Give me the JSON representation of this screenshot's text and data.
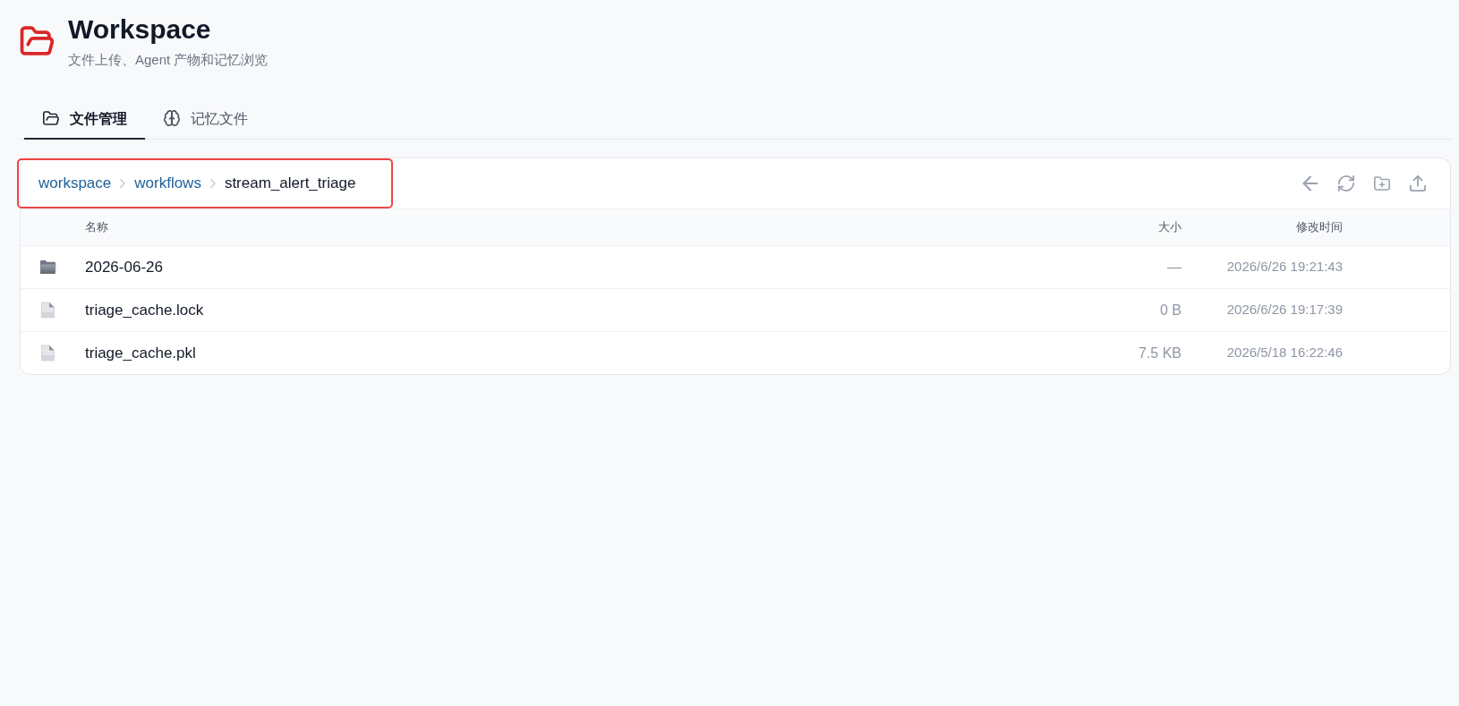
{
  "header": {
    "title": "Workspace",
    "subtitle": "文件上传、Agent 产物和记忆浏览"
  },
  "tabs": [
    {
      "label": "文件管理",
      "kind": "files",
      "selected": true
    },
    {
      "label": "记忆文件",
      "kind": "memory",
      "selected": false
    }
  ],
  "breadcrumb": {
    "highlighted": true,
    "items": [
      {
        "label": "workspace",
        "current": false
      },
      {
        "label": "workflows",
        "current": false
      },
      {
        "label": "stream_alert_triage",
        "current": true
      }
    ]
  },
  "table": {
    "columns": [
      "名称",
      "大小",
      "修改时间"
    ],
    "rows": [
      {
        "kind": "folder",
        "name": "2026-06-26",
        "size": "—",
        "modified": "2026/6/26 19:21:43"
      },
      {
        "kind": "file",
        "name": "triage_cache.lock",
        "size": "0 B",
        "modified": "2026/6/26 19:17:39"
      },
      {
        "kind": "file",
        "name": "triage_cache.pkl",
        "size": "7.5 KB",
        "modified": "2026/5/18 16:22:46"
      }
    ]
  }
}
